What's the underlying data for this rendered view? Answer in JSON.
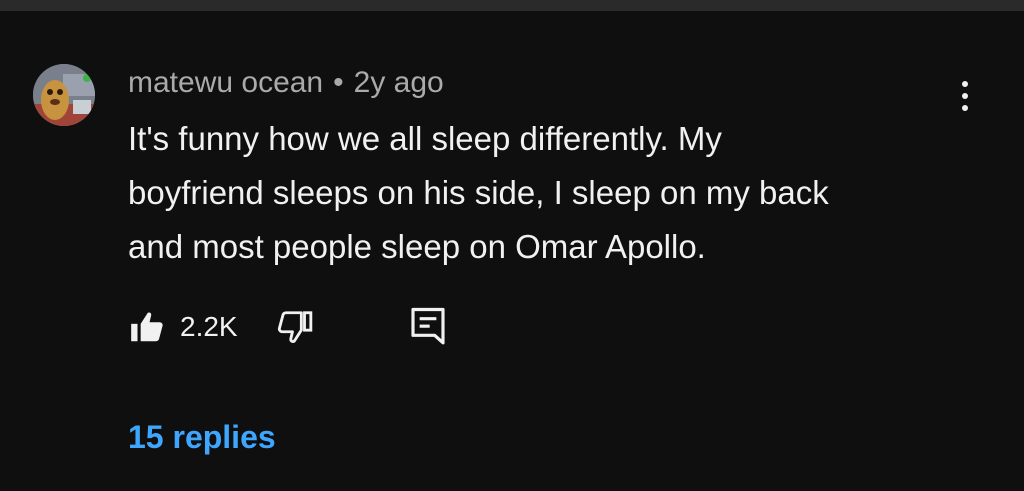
{
  "comment": {
    "author": "matewu ocean",
    "separator": "•",
    "time": "2y ago",
    "text_lines": [
      "It's funny how we all sleep differently. My",
      "boyfriend sleeps on his side, I sleep on my back",
      "and most people sleep on Omar Apollo."
    ],
    "like_count": "2.2K",
    "replies_label": "15 replies"
  },
  "colors": {
    "background": "#0f0f0f",
    "text_primary": "#f1f1f1",
    "text_secondary": "#aaaaaa",
    "link": "#3ea6ff"
  },
  "icons": {
    "like": "thumbs-up-filled-icon",
    "dislike": "thumbs-down-outline-icon",
    "reply": "comment-reply-icon",
    "more": "three-dots-vertical-icon"
  }
}
